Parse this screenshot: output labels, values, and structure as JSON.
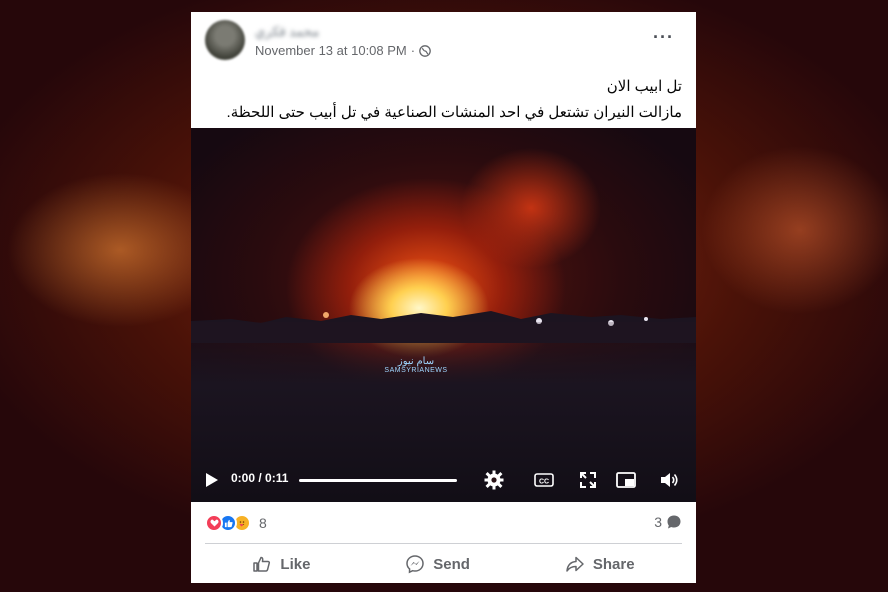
{
  "post": {
    "author": "محمد فكري",
    "timestamp": "November 13 at 10:08 PM",
    "visibility_icon": "globe-icon",
    "more_icon": "more-options-icon",
    "caption_line1": "تل ابيب الان",
    "caption_line2": "مازالت النيران تشتعل في احد المنشات الصناعية في تل أبيب حتى اللحظة."
  },
  "video": {
    "watermark_ar": "سام نيوز",
    "watermark_en": "SAMSYRIANEWS",
    "time": "0:00 / 0:11",
    "progress": 0,
    "controls": [
      "play-icon",
      "settings-icon",
      "captions-icon",
      "fullscreen-icon",
      "pip-icon",
      "volume-icon"
    ]
  },
  "engagement": {
    "reactions": [
      "love-reaction-icon",
      "like-reaction-icon",
      "care-reaction-icon"
    ],
    "reaction_count": "8",
    "comment_count": "3"
  },
  "actions": {
    "like": "Like",
    "send": "Send",
    "share": "Share"
  },
  "colors": {
    "accent": "#1877f2",
    "love": "#f33e58",
    "care": "#f7b125",
    "secondary_text": "#65676b"
  }
}
